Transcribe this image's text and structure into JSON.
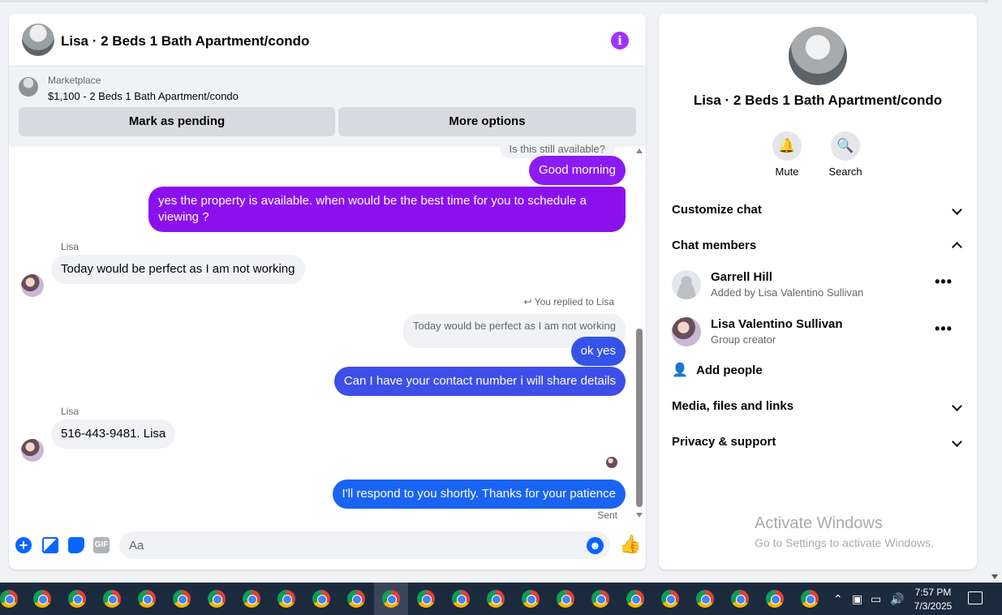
{
  "chat": {
    "title": "Lisa · 2 Beds 1 Bath Apartment/condo",
    "marketplace_label": "Marketplace",
    "listing": "$1,100 - 2 Beds 1 Bath Apartment/condo",
    "mark_pending": "Mark as pending",
    "more_options": "More options",
    "messages": {
      "faded_top": "Is this still available?",
      "good_morning": "Good morning",
      "availability": "yes the property is available. when would be the best time for you to schedule a viewing ?",
      "sender1": "Lisa",
      "today": "Today would be perfect as I am not working",
      "reply_label": "You replied to Lisa",
      "reply_quote": "Today would be perfect as I am not working",
      "ok_yes": "ok yes",
      "contact": "Can I have your contact number i will share details",
      "sender2": "Lisa",
      "phone": "516-443-9481. Lisa",
      "respond": "I'll respond to you shortly. Thanks for your patience",
      "sent": "Sent"
    },
    "composer": {
      "placeholder": "Aa",
      "gif": "GIF"
    }
  },
  "side": {
    "title": "Lisa · 2 Beds 1 Bath Apartment/condo",
    "mute": "Mute",
    "search": "Search",
    "customize_chat": "Customize chat",
    "chat_members": "Chat members",
    "members": [
      {
        "name": "Garrell Hill",
        "sub": "Added by Lisa Valentino Sullivan"
      },
      {
        "name": "Lisa Valentino Sullivan",
        "sub": "Group creator"
      }
    ],
    "add_people": "Add people",
    "media": "Media, files and links",
    "privacy": "Privacy & support"
  },
  "watermark": {
    "line1": "Activate Windows",
    "line2": "Go to Settings to activate Windows."
  },
  "taskbar": {
    "time": "7:57 PM",
    "date": "7/3/2025"
  },
  "colors": {
    "accent_blue": "#0866ff",
    "purple_bubble": "#8a1bf5",
    "info_purple": "#a033ff"
  }
}
